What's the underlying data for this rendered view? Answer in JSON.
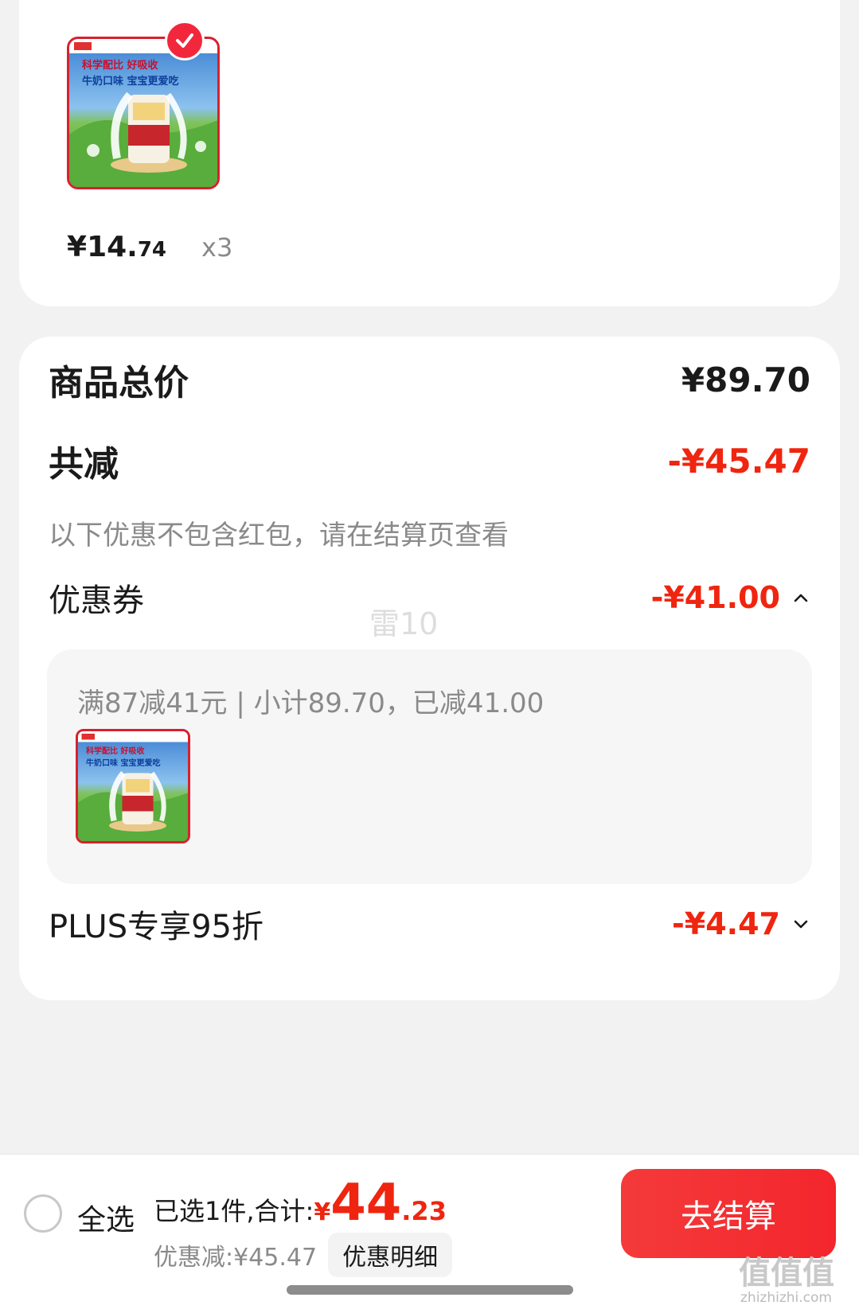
{
  "product": {
    "price_symbol": "¥",
    "price_int": "14.",
    "price_dec": "74",
    "quantity": "x3",
    "image_banner_line1": "科学配比 好吸收",
    "image_banner_line2": "牛奶口味 宝宝更爱吃",
    "selected": true
  },
  "summary": {
    "total_label": "商品总价",
    "total_value": "¥89.70",
    "reduce_label": "共减",
    "reduce_value": "-¥45.47",
    "note": "以下优惠不包含红包，请在结算页查看",
    "coupon_label": "优惠券",
    "coupon_value": "-¥41.00",
    "coupon_detail": "满87减41元 | 小计89.70，已减41.00",
    "plus_label": "PLUS专享95折",
    "plus_value": "-¥4.47",
    "watermark": "雷10"
  },
  "bottom": {
    "select_all": "全选",
    "sum_label": "已选1件,合计:",
    "sum_symbol": "¥",
    "sum_int": "44",
    "sum_dec": ".23",
    "discount_text": "优惠减:¥45.47",
    "detail_button": "优惠明细",
    "checkout_button": "去结算"
  },
  "logo": {
    "mark": "值值值",
    "sub": "zhizhizhi.com"
  },
  "colors": {
    "accent_red": "#f0250f",
    "button_red": "#f3262c",
    "muted_text": "#8a8a8a"
  }
}
